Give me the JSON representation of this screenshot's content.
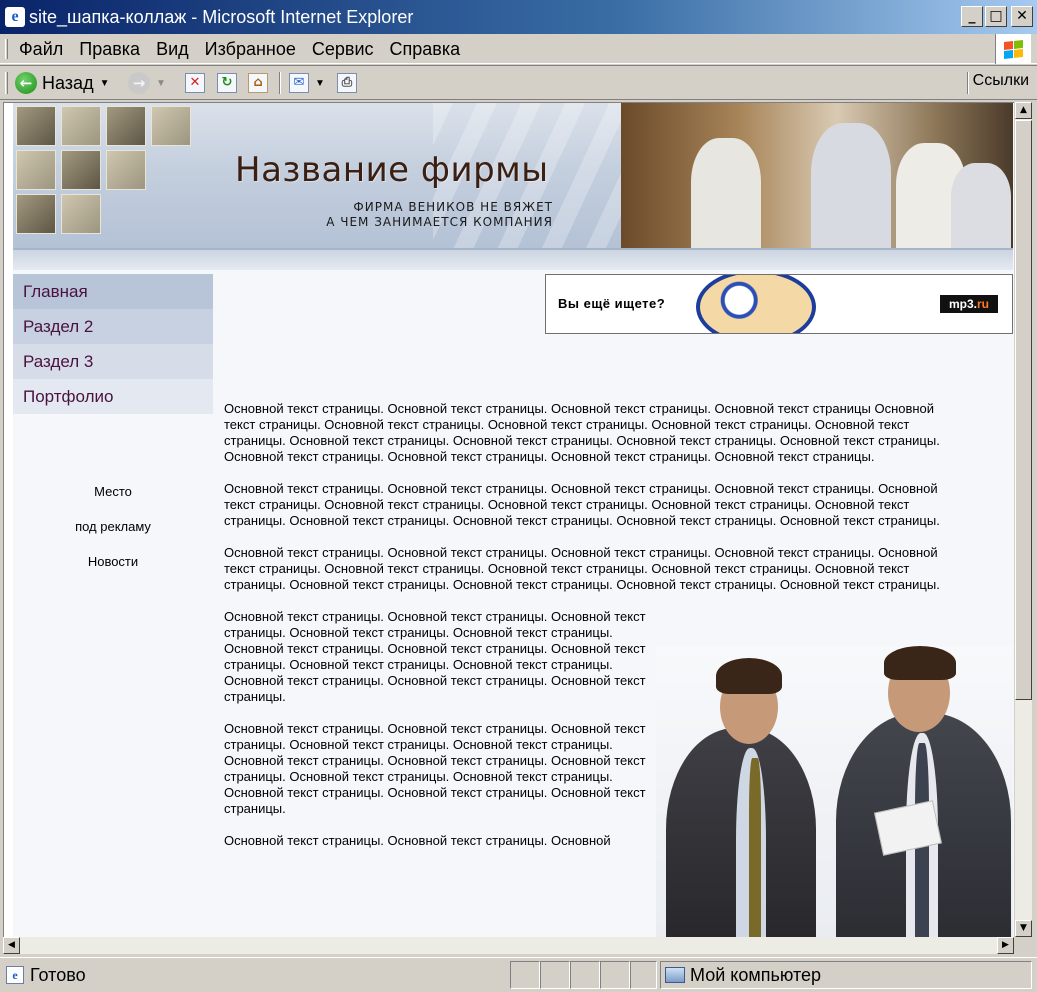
{
  "window": {
    "title": "site_шапка-коллаж - Microsoft Internet Explorer",
    "minimize": "_",
    "maximize": "□",
    "close": "✕",
    "icon": "ie-page-icon"
  },
  "menu": {
    "items": [
      "Файл",
      "Правка",
      "Вид",
      "Избранное",
      "Сервис",
      "Справка"
    ]
  },
  "toolbar": {
    "back_label": "Назад",
    "links_label": "Ссылки",
    "icons": [
      "back-icon",
      "forward-icon",
      "stop-icon",
      "refresh-icon",
      "home-icon",
      "mail-icon",
      "print-icon"
    ]
  },
  "header": {
    "company_name": "Название фирмы",
    "slogan_line1": "ФИРМА ВЕНИКОВ НЕ ВЯЖЕТ",
    "slogan_line2": "А ЧЕМ ЗАНИМАЕТСЯ КОМПАНИЯ"
  },
  "nav": {
    "items": [
      "Главная",
      "Раздел 2",
      "Раздел 3",
      "Портфолио"
    ]
  },
  "sidebar": {
    "line1": "Место",
    "line2": "под рекламу",
    "line3": "Новости"
  },
  "ad": {
    "text": "Вы  ещё  ищете?",
    "logo_main": "mp3.",
    "logo_ru": "ru"
  },
  "content": {
    "p1": "Основной текст страницы. Основной текст страницы. Основной текст страницы. Основной текст страницы Основной текст страницы. Основной текст страницы. Основной текст страницы. Основной текст страницы. Основной текст страницы. Основной текст страницы. Основной текст страницы. Основной текст страницы. Основной текст страницы. Основной текст страницы. Основной текст страницы. Основной текст страницы. Основной текст страницы.",
    "p2": "Основной текст страницы. Основной текст страницы. Основной текст страницы. Основной текст страницы. Основной текст страницы. Основной текст страницы. Основной текст страницы. Основной текст страницы. Основной текст страницы. Основной текст страницы. Основной текст страницы. Основной текст страницы. Основной текст страницы.",
    "p3": "Основной текст страницы. Основной текст страницы. Основной текст страницы. Основной текст страницы. Основной текст страницы. Основной текст страницы. Основной текст страницы. Основной текст страницы. Основной текст страницы. Основной текст страницы. Основной текст страницы. Основной текст страницы. Основной текст страницы.",
    "p4": "Основной текст страницы. Основной текст страницы. Основной текст страницы. Основной текст страницы. Основной текст страницы. Основной текст страницы. Основной текст страницы. Основной текст страницы. Основной текст страницы. Основной текст страницы. Основной текст страницы. Основной текст страницы. Основной текст страницы.",
    "p5": "Основной текст страницы. Основной текст страницы. Основной текст страницы. Основной текст страницы. Основной текст страницы. Основной текст страницы. Основной текст страницы. Основной текст страницы. Основной текст страницы. Основной текст страницы. Основной текст страницы. Основной текст страницы. Основной текст страницы.",
    "p6": "Основной текст страницы. Основной текст страницы. Основной"
  },
  "status": {
    "text": "Готово",
    "zone": "Мой компьютер"
  }
}
